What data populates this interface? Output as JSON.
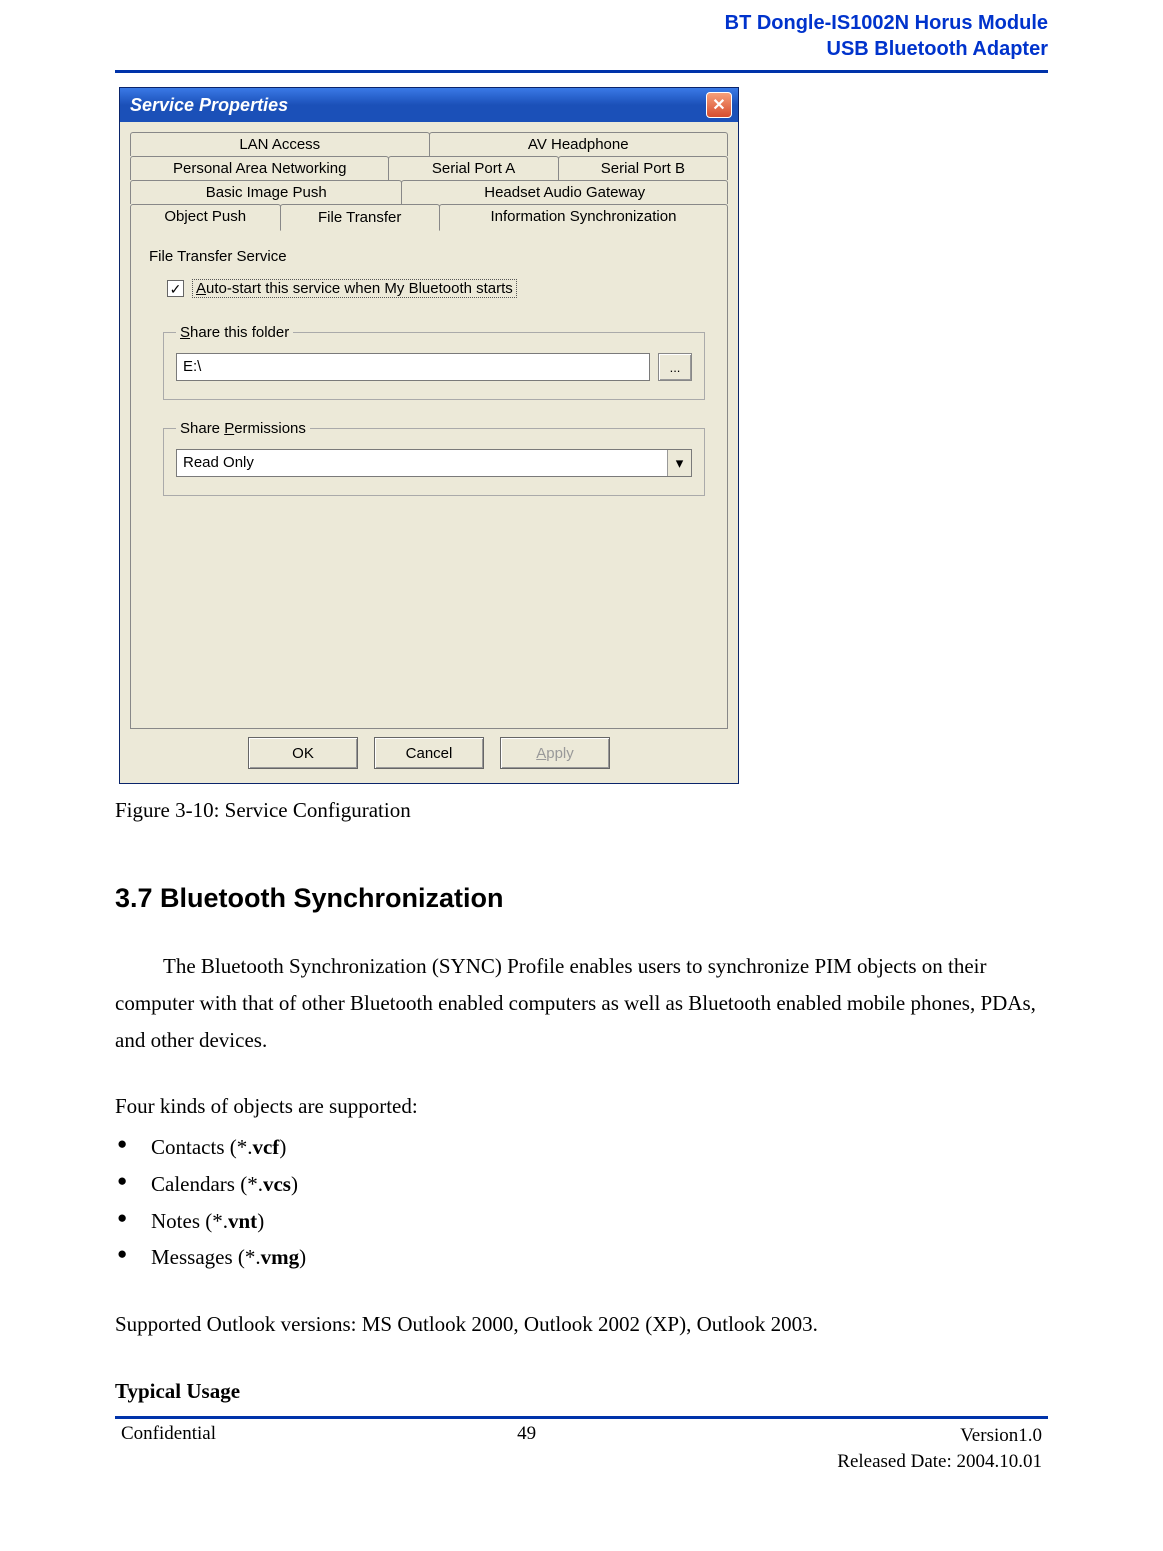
{
  "header": {
    "line1": "BT Dongle-IS1002N Horus Module",
    "line2": "USB Bluetooth Adapter"
  },
  "dialog": {
    "title": "Service Properties",
    "close_glyph": "✕",
    "tabs": {
      "row1": [
        "LAN Access",
        "AV Headphone"
      ],
      "row2": [
        "Personal Area Networking",
        "Serial Port A",
        "Serial Port B"
      ],
      "row3": [
        "Basic Image Push",
        "Headset Audio Gateway"
      ],
      "row4": [
        "Object Push",
        "File Transfer",
        "Information Synchronization"
      ],
      "active": "File Transfer"
    },
    "service_label": "File Transfer Service",
    "checkbox": {
      "checked_glyph": "✓",
      "label_prefix": "A",
      "label_rest": "uto-start this service when My Bluetooth starts"
    },
    "share_folder": {
      "legend_prefix": "S",
      "legend_rest": "hare this folder",
      "value": "E:\\",
      "browse": "..."
    },
    "share_perm": {
      "legend_pre": "Share ",
      "legend_u": "P",
      "legend_post": "ermissions",
      "value": "Read Only",
      "arrow": "▾"
    },
    "buttons": {
      "ok": "OK",
      "cancel": "Cancel",
      "apply_u": "A",
      "apply_rest": "pply"
    }
  },
  "caption": "Figure 3-10: Service Configuration",
  "section": {
    "heading": "3.7    Bluetooth Synchronization",
    "para1": "The Bluetooth Synchronization (SYNC) Profile enables users to synchronize PIM objects on their computer with that of other Bluetooth enabled computers as well as Bluetooth enabled mobile phones, PDAs, and other devices.",
    "list_intro": "Four kinds of objects are supported:",
    "items": [
      {
        "pre": "Contacts (*.",
        "bold": "vcf",
        "post": ")"
      },
      {
        "pre": "Calendars (*.",
        "bold": "vcs",
        "post": ")"
      },
      {
        "pre": "Notes (*.",
        "bold": "vnt",
        "post": ")"
      },
      {
        "pre": "Messages (*.",
        "bold": "vmg",
        "post": ")"
      }
    ],
    "outlook": "Supported Outlook versions: MS Outlook 2000, Outlook 2002 (XP), Outlook 2003.",
    "typical": "Typical Usage"
  },
  "footer": {
    "left": "Confidential",
    "center": "49",
    "right1": "Version1.0",
    "right2": "Released Date: 2004.10.01"
  }
}
